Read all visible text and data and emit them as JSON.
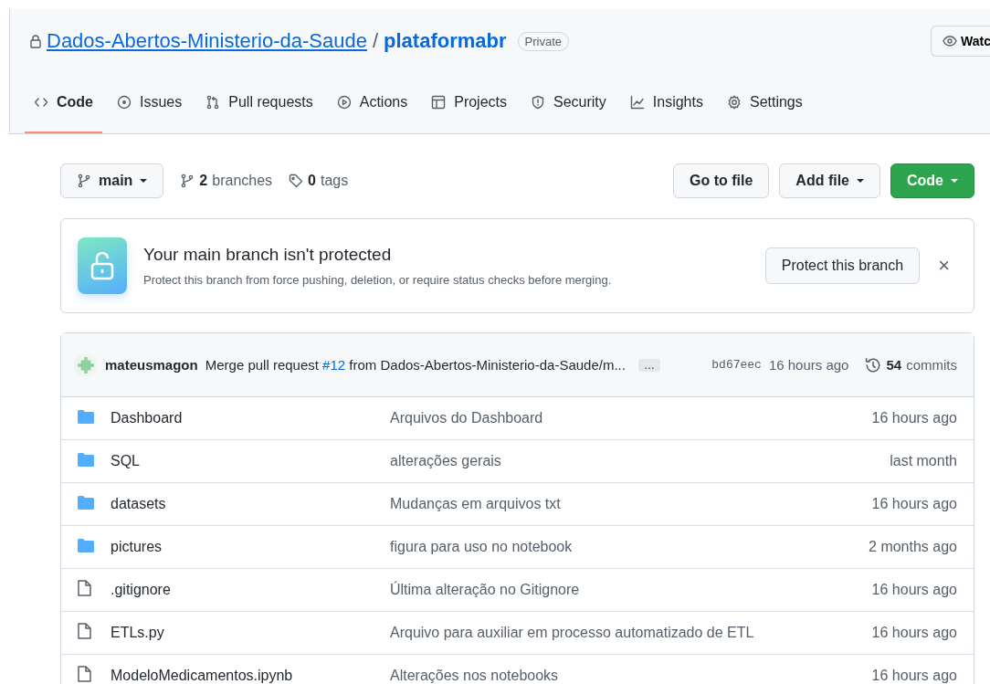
{
  "repo": {
    "owner": "Dados-Abertos-Ministerio-da-Saude",
    "separator": "/",
    "name": "plataformabr",
    "visibility": "Private",
    "watch_button": "Watc"
  },
  "tabs": [
    {
      "label": "Code",
      "kind": "code",
      "selected": true
    },
    {
      "label": "Issues",
      "kind": "issue",
      "selected": false
    },
    {
      "label": "Pull requests",
      "kind": "pr",
      "selected": false
    },
    {
      "label": "Actions",
      "kind": "play",
      "selected": false
    },
    {
      "label": "Projects",
      "kind": "table",
      "selected": false
    },
    {
      "label": "Security",
      "kind": "shield",
      "selected": false
    },
    {
      "label": "Insights",
      "kind": "graph",
      "selected": false
    },
    {
      "label": "Settings",
      "kind": "gear",
      "selected": false
    }
  ],
  "toolbar": {
    "branch": "main",
    "branches_count": "2",
    "branches_label": "branches",
    "tags_count": "0",
    "tags_label": "tags",
    "go_to_file": "Go to file",
    "add_file": "Add file",
    "code": "Code"
  },
  "banner": {
    "title": "Your main branch isn't protected",
    "description": "Protect this branch from force pushing, deletion, or require status checks before merging.",
    "button": "Protect this branch",
    "close": "×"
  },
  "commit": {
    "author": "mateusmagon",
    "message_before": "Merge pull request",
    "pr_link": "#12",
    "message_after": "from Dados-Abertos-Ministerio-da-Saude/m...",
    "ellipsis": "…",
    "sha": "bd67eec",
    "time": "16 hours ago",
    "commits_count": "54",
    "commits_label": "commits"
  },
  "files": [
    {
      "kind": "folder",
      "name": "Dashboard",
      "message": "Arquivos do Dashboard",
      "time": "16 hours ago"
    },
    {
      "kind": "folder",
      "name": "SQL",
      "message": "alterações gerais",
      "time": "last month"
    },
    {
      "kind": "folder",
      "name": "datasets",
      "message": "Mudanças em arquivos txt",
      "time": "16 hours ago"
    },
    {
      "kind": "folder",
      "name": "pictures",
      "message": "figura para uso no notebook",
      "time": "2 months ago"
    },
    {
      "kind": "file",
      "name": ".gitignore",
      "message": "Última alteração no Gitignore",
      "time": "16 hours ago"
    },
    {
      "kind": "file",
      "name": "ETLs.py",
      "message": "Arquivo para auxiliar em processo automatizado de ETL",
      "time": "16 hours ago"
    },
    {
      "kind": "file",
      "name": "ModeloMedicamentos.ipynb",
      "message": "Alterações nos notebooks",
      "time": "16 hours ago"
    }
  ]
}
